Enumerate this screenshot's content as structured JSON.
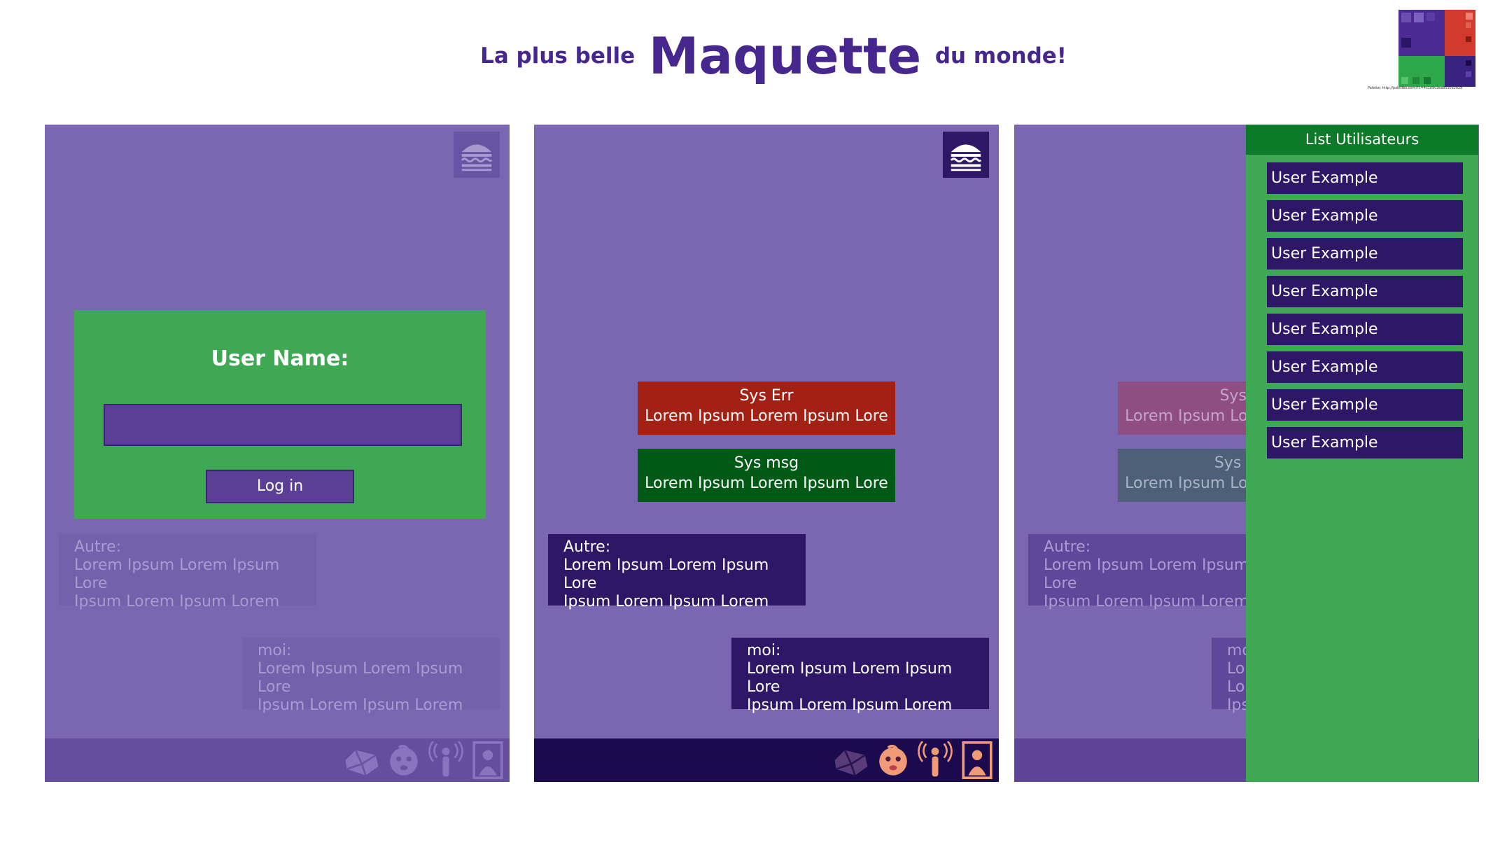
{
  "header": {
    "prefix": "La plus belle",
    "main": "Maquette",
    "suffix": "du monde!",
    "palette_note": "Palette: http://palettes.com/?c=4c1e9c3ea853c6302d"
  },
  "colors": {
    "purple_bg": "#7b66b2",
    "dark_purple": "#2e1766",
    "green": "#3ea853",
    "dark_green": "#005a16",
    "red": "#a32014",
    "title": "#45278e"
  },
  "login": {
    "label": "User Name:",
    "input_value": "",
    "button": "Log in"
  },
  "messages": {
    "sys_err_title": "Sys Err",
    "sys_msg_title": "Sys msg",
    "sys_body": "Lorem Ipsum Lorem Ipsum Lore",
    "other_label": "Autre:",
    "me_label": "moi:",
    "line1": "Lorem Ipsum Lorem Ipsum Lore",
    "line2": "Ipsum Lorem Ipsum Lorem"
  },
  "sidebar": {
    "title": "List Utilisateurs",
    "items": [
      "User Example",
      "User Example",
      "User Example",
      "User Example",
      "User Example",
      "User Example",
      "User Example",
      "User Example"
    ]
  },
  "icons": [
    "menu-burger-icon",
    "envelope-icon",
    "baby-face-icon",
    "broadcast-person-icon",
    "mona-lisa-frame-icon"
  ]
}
